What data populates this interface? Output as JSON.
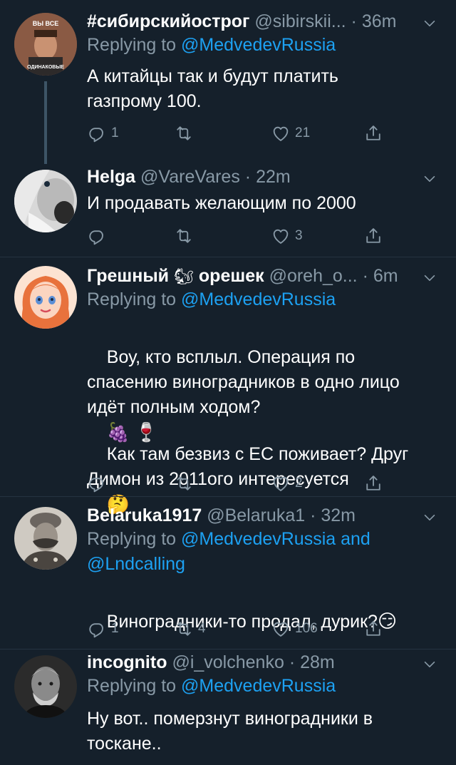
{
  "colors": {
    "background": "#15202b",
    "text_primary": "#ffffff",
    "text_secondary": "#8899a6",
    "link": "#1da1f2",
    "divider": "#253341",
    "thread_line": "#3d5466"
  },
  "tweets": [
    {
      "name": "#сибирскийострог",
      "handle": "@sibirskii...",
      "separator": "·",
      "time": "36m",
      "replying_prefix": "Replying to",
      "replying_mentions": [
        "@MedvedevRussia"
      ],
      "text": "А китайцы так и будут платить\nгазпрому 100.",
      "avatar_text_top": "ВЫ ВСЕ",
      "avatar_text_bottom": "ОДИНАКОВЫЕ",
      "replies": "1",
      "retweets": "",
      "likes": "21"
    },
    {
      "name": "Helga",
      "handle": "@VareVares",
      "separator": "·",
      "time": "22m",
      "text": "И продавать желающим по 2000",
      "replies": "",
      "retweets": "",
      "likes": "3"
    },
    {
      "name_part1": "Грешный",
      "name_emoji": "🐿",
      "name_part2": "орешек",
      "handle": "@oreh_o...",
      "separator": "·",
      "time": "6m",
      "replying_prefix": "Replying to",
      "replying_mentions": [
        "@MedvedevRussia"
      ],
      "text_p1": "Воу, кто всплыл. Операция по\nспасению виноградников в одно лицо\nидёт полным ходом?",
      "text_p1_emojis": "🍇 🍷",
      "text_p2": "Как там безвиз с ЕС поживает? Друг\nДимон из 2011ого интересуется",
      "text_p2_emoji": "🤔",
      "replies": "",
      "retweets": "",
      "likes": "2"
    },
    {
      "name": "Belaruka1917",
      "handle": "@Belaruka1",
      "separator": "·",
      "time": "32m",
      "replying_prefix": "Replying to",
      "replying_mentions": [
        "@MedvedevRussia",
        "@Lndcalling"
      ],
      "replying_and": "and",
      "text": "Виноградники-то продал, дурик?",
      "text_emoji": "😏",
      "replies": "1",
      "retweets": "4",
      "likes": "106"
    },
    {
      "name": "incognito",
      "handle": "@i_volchenko",
      "separator": "·",
      "time": "28m",
      "replying_prefix": "Replying to",
      "replying_mentions": [
        "@MedvedevRussia"
      ],
      "text": "Ну вот.. померзнут виноградники в\nтоскане.."
    }
  ],
  "icons": {
    "reply": "reply-icon",
    "retweet": "retweet-icon",
    "like": "like-icon",
    "share": "share-icon",
    "more": "chevron-down-icon"
  }
}
